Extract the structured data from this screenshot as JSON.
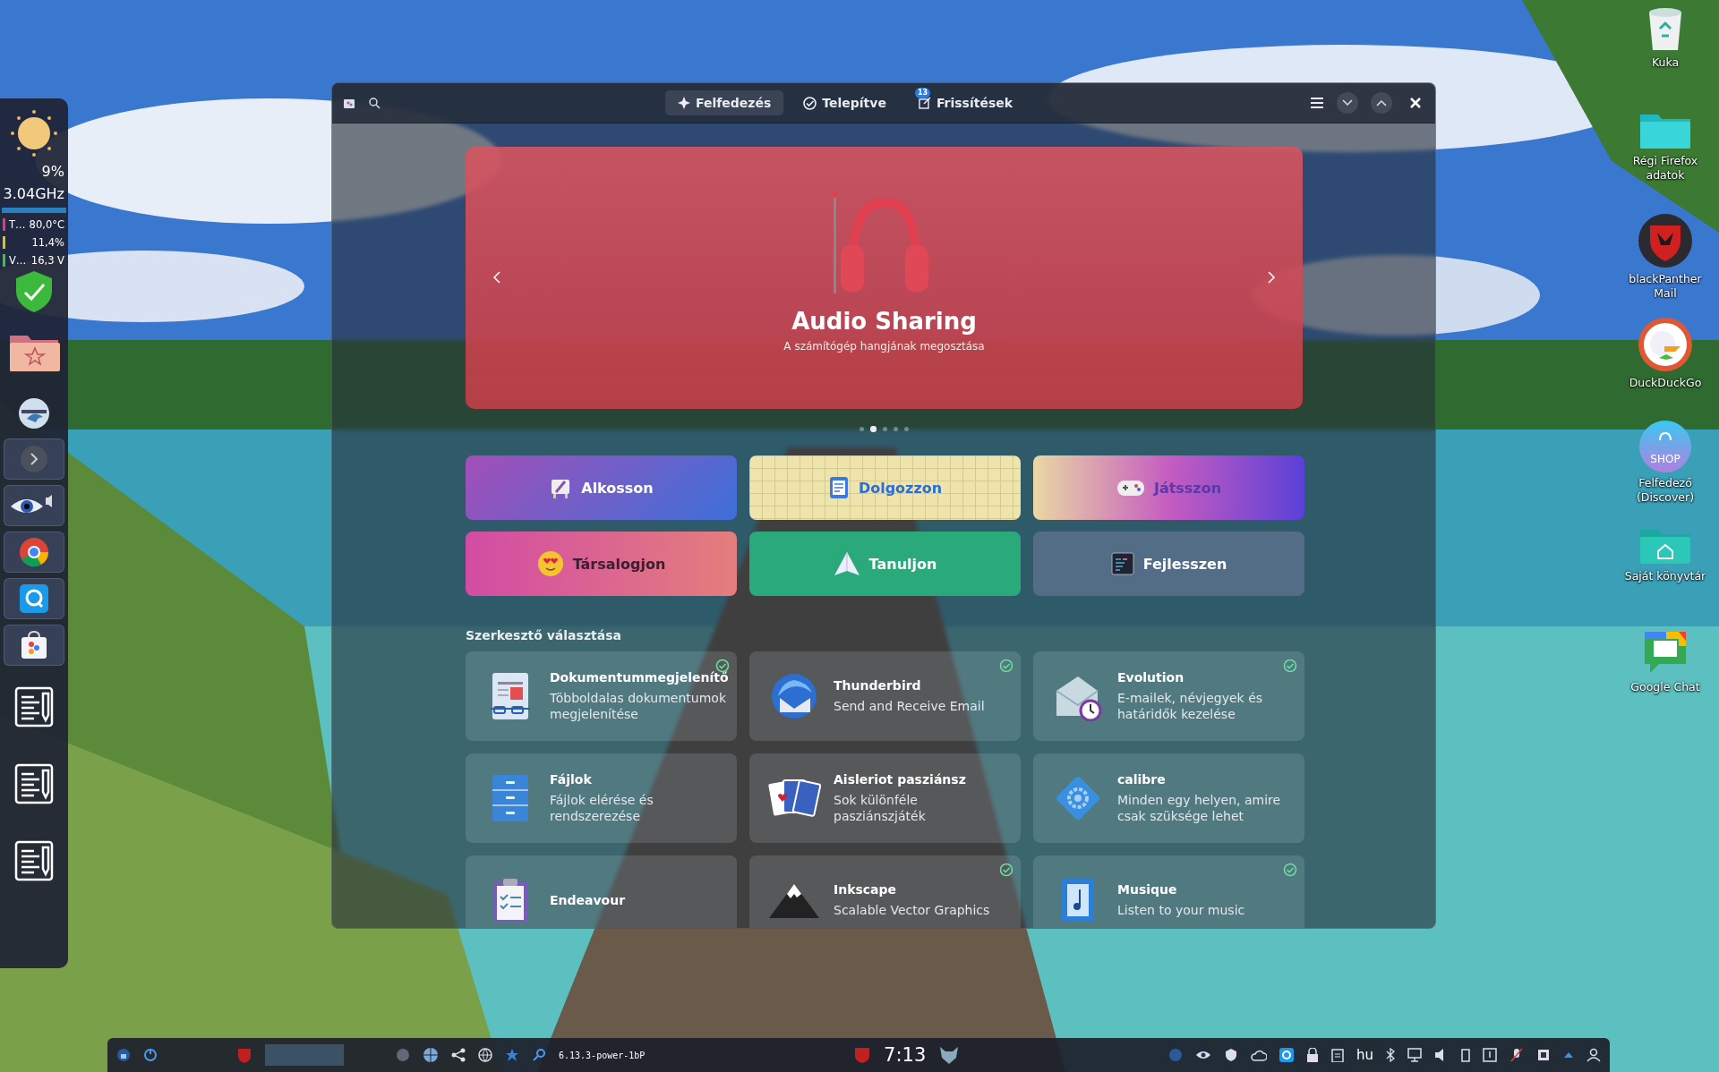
{
  "side_panel": {
    "cpu_load": "9%",
    "cpu_freq": "3.04GHz",
    "sensors": [
      {
        "label": "T…",
        "value": "80,0°C",
        "color": "#e8387a"
      },
      {
        "value": "11,4%",
        "color": "#e0c020"
      },
      {
        "label": "V…",
        "value": "16,3 V",
        "color": "#3cc43c"
      }
    ]
  },
  "window": {
    "tabs": [
      {
        "label": "Felfedezés",
        "selected": true,
        "kind": "explore"
      },
      {
        "label": "Telepítve",
        "selected": false,
        "kind": "installed"
      },
      {
        "label": "Frissítések",
        "selected": false,
        "kind": "updates",
        "badge": "13"
      }
    ],
    "banner": {
      "title": "Audio Sharing",
      "subtitle": "A számítógép hangjának megosztása"
    },
    "carousel_dots": [
      {
        "selected": false
      },
      {
        "selected": true
      },
      {
        "selected": false
      },
      {
        "selected": false
      },
      {
        "selected": false
      }
    ],
    "categories": [
      {
        "label": "Alkosson",
        "kind": "create"
      },
      {
        "label": "Dolgozzon",
        "kind": "work"
      },
      {
        "label": "Játsszon",
        "kind": "play"
      },
      {
        "label": "Társalogjon",
        "kind": "social"
      },
      {
        "label": "Tanuljon",
        "kind": "learn"
      },
      {
        "label": "Fejlesszen",
        "kind": "develop"
      }
    ],
    "section_title": "Szerkesztő választása",
    "apps": [
      {
        "name": "Dokumentummegjelenítő",
        "description": "Többoldalas dokumentumok megjelenítése",
        "installed": true,
        "kind": "document"
      },
      {
        "name": "Thunderbird",
        "description": "Send and Receive Email",
        "installed": true,
        "kind": "bird"
      },
      {
        "name": "Evolution",
        "description": "E-mailek, névjegyek és határidők kezelése",
        "installed": true,
        "kind": "envelope"
      },
      {
        "name": "Fájlok",
        "description": "Fájlok elérése és rendszerezése",
        "installed": false,
        "kind": "cabinet"
      },
      {
        "name": "Aisleriot pasziánsz",
        "description": "Sok különféle pasziánszjáték",
        "installed": false,
        "kind": "cards"
      },
      {
        "name": "calibre",
        "description": "Minden egy helyen, amire csak szüksége lehet",
        "installed": false,
        "kind": "gear"
      },
      {
        "name": "Endeavour",
        "installed": false,
        "kind": "clipboard"
      },
      {
        "name": "Inkscape",
        "description": "Scalable Vector Graphics",
        "installed": true,
        "kind": "mountain"
      },
      {
        "name": "Musique",
        "description": "Listen to your music",
        "installed": true,
        "kind": "music"
      }
    ]
  },
  "desktop_icons": [
    {
      "label": "Kuka",
      "kind": "trash"
    },
    {
      "label": "Régi Firefox adatok",
      "kind": "folder"
    },
    {
      "label": "blackPanther Mail",
      "kind": "mail"
    },
    {
      "label": "DuckDuckGo",
      "kind": "duck"
    },
    {
      "label": "Felfedező (Discover)",
      "kind": "shop",
      "badge": "SHOP"
    },
    {
      "label": "Saját könyvtár",
      "kind": "home"
    },
    {
      "label": "Google Chat",
      "kind": "chat"
    }
  ],
  "taskbar": {
    "kernel": "6.13.3-power-1bP",
    "clock": "7:13",
    "keyboard_layout": "hu"
  }
}
